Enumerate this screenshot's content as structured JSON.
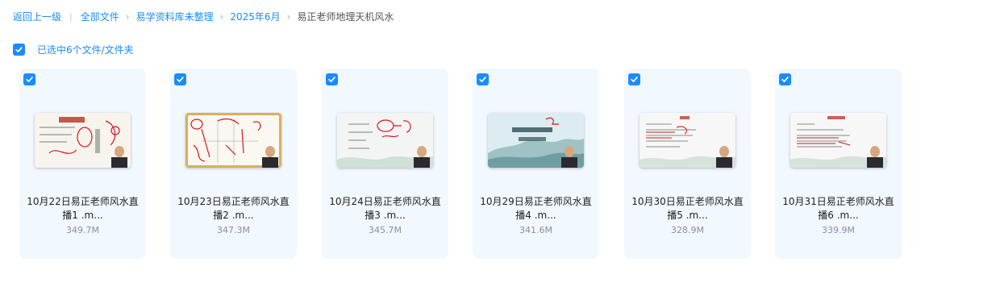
{
  "breadcrumb": {
    "back": "返回上一级",
    "items": [
      "全部文件",
      "易学资料库未整理",
      "2025年6月"
    ],
    "current": "易正老师地理天机风水"
  },
  "selection": {
    "label": "已选中6个文件/文件夹",
    "checked": true
  },
  "files": [
    {
      "name_line1": "10月22日易正老师风水直",
      "name_line2": "播1 .m...",
      "size": "349.7M",
      "checked": true
    },
    {
      "name_line1": "10月23日易正老师风水直",
      "name_line2": "播2 .m...",
      "size": "347.3M",
      "checked": true
    },
    {
      "name_line1": "10月24日易正老师风水直",
      "name_line2": "播3 .m...",
      "size": "345.7M",
      "checked": true
    },
    {
      "name_line1": "10月29日易正老师风水直",
      "name_line2": "播4 .m...",
      "size": "341.6M",
      "checked": true
    },
    {
      "name_line1": "10月30日易正老师风水直",
      "name_line2": "播5 .m...",
      "size": "328.9M",
      "checked": true
    },
    {
      "name_line1": "10月31日易正老师风水直",
      "name_line2": "播6 .m...",
      "size": "339.9M",
      "checked": true
    }
  ],
  "colors": {
    "accent": "#1a8cff",
    "card_bg": "#f1f8fe",
    "size_text": "#8a8f99"
  },
  "icons": {
    "checkbox": "checkbox-checked-icon",
    "breadcrumb_separator": "chevron-right-icon"
  }
}
